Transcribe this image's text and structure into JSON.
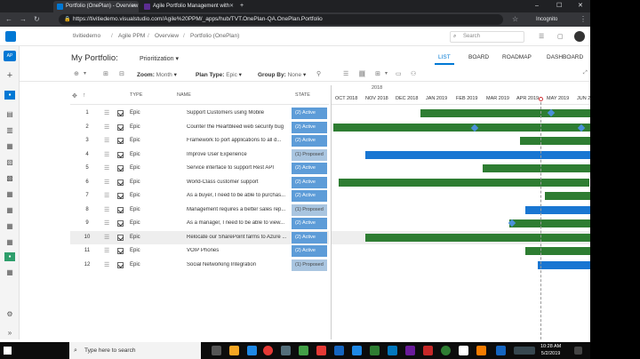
{
  "browser": {
    "tabs": [
      {
        "label": "Portfolio (OnePlan) - Overview"
      },
      {
        "label": "Agile Portfolio Management with"
      }
    ],
    "url": "https://tivitiedemo.visualstudio.com/Agile%20PPM/_apps/hub/TVT.OnePlan-QA.OnePlan.Portfolio",
    "incognito": "Incognito"
  },
  "ado": {
    "breadcrumb": [
      "tivitiedemo",
      "Agile PPM",
      "Overview",
      "Portfolio (OnePlan)"
    ],
    "search_placeholder": "Search"
  },
  "rail": {
    "top_badge": "AP"
  },
  "portfolio": {
    "title": "My Portfolio:",
    "view": "Prioritization",
    "tabs": [
      "LIST",
      "BOARD",
      "ROADMAP",
      "DASHBOARD"
    ],
    "active_tab": "LIST"
  },
  "toolbar": {
    "zoom_label": "Zoom:",
    "zoom_value": "Month",
    "plan_label": "Plan Type:",
    "plan_value": "Epic",
    "group_label": "Group By:",
    "group_value": "None"
  },
  "grid": {
    "columns": {
      "type": "TYPE",
      "name": "NAME",
      "state": "STATE"
    },
    "rows": [
      {
        "id": "1",
        "type": "Epic",
        "name": "Support Customers using Mobile",
        "state": "(2) Active"
      },
      {
        "id": "2",
        "type": "Epic",
        "name": "Counter the Heartbleed web security bug",
        "state": "(2) Active"
      },
      {
        "id": "3",
        "type": "Epic",
        "name": "Framework to port applications to all d...",
        "state": "(2) Active"
      },
      {
        "id": "4",
        "type": "Epic",
        "name": "Improve User Experience",
        "state": "(1) Proposed"
      },
      {
        "id": "5",
        "type": "Epic",
        "name": "Service interface to support Rest API",
        "state": "(2) Active"
      },
      {
        "id": "6",
        "type": "Epic",
        "name": "World-Class customer support",
        "state": "(2) Active"
      },
      {
        "id": "7",
        "type": "Epic",
        "name": "As a buyer, I need to be able to purchas...",
        "state": "(2) Active"
      },
      {
        "id": "8",
        "type": "Epic",
        "name": "Management requires a better sales rep...",
        "state": "(1) Proposed"
      },
      {
        "id": "9",
        "type": "Epic",
        "name": "As a manager, I need to be able to view...",
        "state": "(2) Active"
      },
      {
        "id": "10",
        "type": "Epic",
        "name": "Relocate our SharePoint farms to Azure ...",
        "state": "(2) Active"
      },
      {
        "id": "11",
        "type": "Epic",
        "name": "VOIP Phones",
        "state": "(2) Active"
      },
      {
        "id": "12",
        "type": "Epic",
        "name": "Social Networking Integration",
        "state": "(1) Proposed"
      }
    ]
  },
  "timeline": {
    "year": "2018",
    "months": [
      "OCT 2018",
      "NOV 2018",
      "DEC 2018",
      "JAN 2019",
      "FEB 2019",
      "MAR 2019",
      "APR 2019",
      "MAY 2019",
      "JUN 2019"
    ],
    "bars": [
      {
        "row": 1,
        "start": "JAN 2019",
        "color": "#2e7d32"
      },
      {
        "row": 2,
        "start": "OCT 2018",
        "color": "#2e7d32"
      },
      {
        "row": 3,
        "start": "APR 2019",
        "color": "#2e7d32"
      },
      {
        "row": 4,
        "start": "NOV 2018",
        "color": "#1976d2"
      },
      {
        "row": 5,
        "start": "MAR 2019",
        "color": "#2e7d32"
      },
      {
        "row": 6,
        "start": "OCT 2018",
        "color": "#2e7d32"
      },
      {
        "row": 7,
        "start": "MAY 2019",
        "color": "#2e7d32"
      },
      {
        "row": 8,
        "start": "APR 2019",
        "color": "#1976d2"
      },
      {
        "row": 9,
        "start": "APR 2019",
        "color": "#2e7d32"
      },
      {
        "row": 10,
        "start": "NOV 2018",
        "color": "#2e7d32"
      },
      {
        "row": 11,
        "start": "APR 2019",
        "color": "#2e7d32"
      },
      {
        "row": 12,
        "start": "APR 2019",
        "color": "#1976d2"
      }
    ]
  },
  "taskbar": {
    "search_placeholder": "Type here to search",
    "time": "10:28 AM",
    "date": "5/2/2019"
  }
}
